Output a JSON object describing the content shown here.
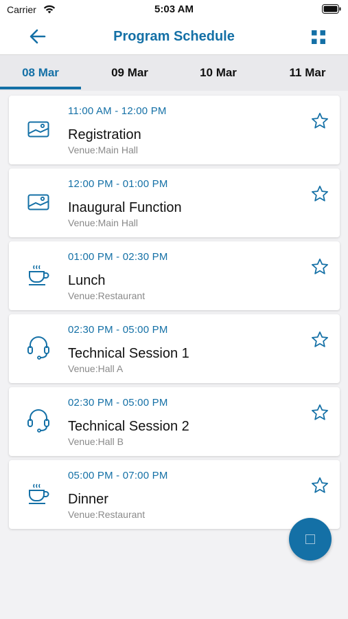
{
  "status_bar": {
    "carrier": "Carrier",
    "time": "5:03 AM"
  },
  "header": {
    "title": "Program Schedule",
    "back_icon": "arrow-left-icon",
    "menu_icon": "grid-icon"
  },
  "tabs": [
    {
      "label": "08 Mar",
      "active": true
    },
    {
      "label": "09 Mar",
      "active": false
    },
    {
      "label": "10 Mar",
      "active": false
    },
    {
      "label": "11 Mar",
      "active": false
    }
  ],
  "events": [
    {
      "time": "11:00 AM - 12:00 PM",
      "title": "Registration",
      "venue": "Venue:Main Hall",
      "icon": "image-icon"
    },
    {
      "time": "12:00 PM - 01:00 PM",
      "title": "Inaugural Function",
      "venue": "Venue:Main Hall",
      "icon": "image-icon"
    },
    {
      "time": "01:00 PM - 02:30 PM",
      "title": "Lunch",
      "venue": "Venue:Restaurant",
      "icon": "coffee-cup-icon"
    },
    {
      "time": "02:30 PM - 05:00 PM",
      "title": "Technical Session 1",
      "venue": "Venue:Hall A",
      "icon": "headset-icon"
    },
    {
      "time": "02:30 PM - 05:00 PM",
      "title": "Technical Session 2",
      "venue": "Venue:Hall B",
      "icon": "headset-icon"
    },
    {
      "time": "05:00 PM - 07:00 PM",
      "title": "Dinner",
      "venue": "Venue:Restaurant",
      "icon": "coffee-cup-icon"
    }
  ],
  "colors": {
    "accent": "#1470a6",
    "background": "#f2f2f4",
    "tab_bar": "#e9e9ec",
    "venue_text": "#8a8a8a"
  }
}
